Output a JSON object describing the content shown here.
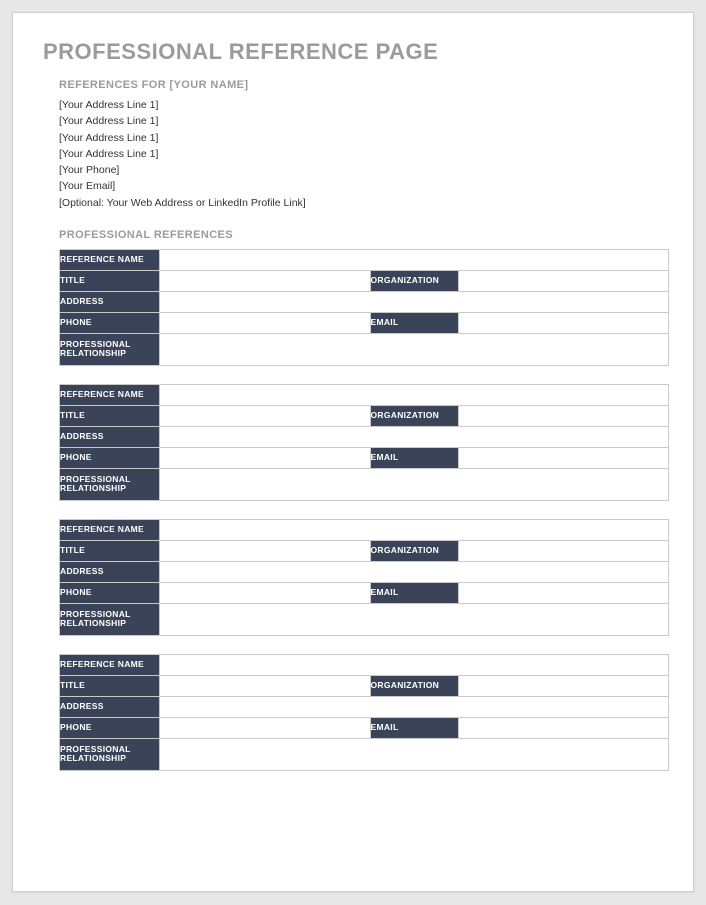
{
  "title": "PROFESSIONAL REFERENCE PAGE",
  "subtitle": "REFERENCES FOR [YOUR NAME]",
  "info_lines": [
    "[Your Address Line 1]",
    "[Your Address Line 1]",
    "[Your Address Line 1]",
    "[Your Address Line 1]",
    "[Your Phone]",
    "[Your Email]",
    "[Optional: Your Web Address or LinkedIn Profile Link]"
  ],
  "section_title": "PROFESSIONAL REFERENCES",
  "labels": {
    "reference_name": "REFERENCE NAME",
    "title": "TITLE",
    "organization": "ORGANIZATION",
    "address": "ADDRESS",
    "phone": "PHONE",
    "email": "EMAIL",
    "relationship": "PROFESSIONAL RELATIONSHIP"
  },
  "references": [
    {
      "reference_name": "",
      "title": "",
      "organization": "",
      "address": "",
      "phone": "",
      "email": "",
      "relationship": ""
    },
    {
      "reference_name": "",
      "title": "",
      "organization": "",
      "address": "",
      "phone": "",
      "email": "",
      "relationship": ""
    },
    {
      "reference_name": "",
      "title": "",
      "organization": "",
      "address": "",
      "phone": "",
      "email": "",
      "relationship": ""
    },
    {
      "reference_name": "",
      "title": "",
      "organization": "",
      "address": "",
      "phone": "",
      "email": "",
      "relationship": ""
    }
  ]
}
